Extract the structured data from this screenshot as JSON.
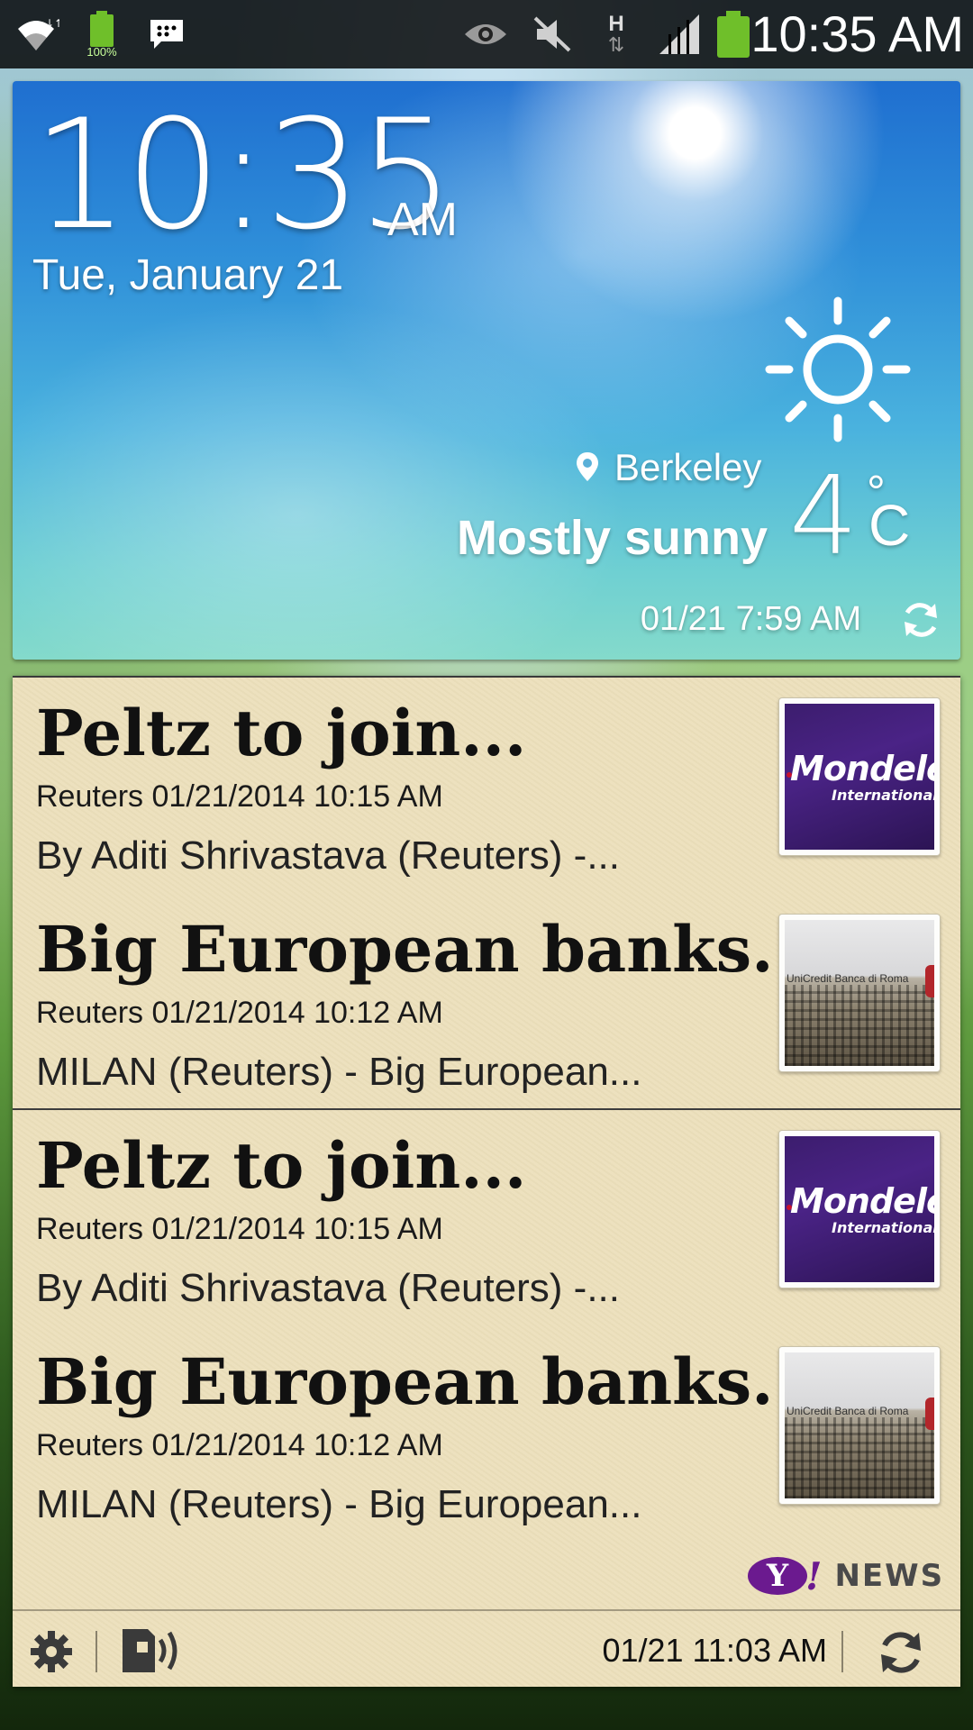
{
  "status_bar": {
    "icons": [
      "wifi-icon",
      "battery-small-icon",
      "bbm-message-icon",
      "eye-icon",
      "mute-icon",
      "network-h-icon",
      "signal-icon",
      "battery-icon"
    ],
    "battery_percent_label": "100%",
    "network_type": "H",
    "time": "10:35 AM"
  },
  "clock_widget": {
    "time": "10:35",
    "ampm": "AM",
    "date": "Tue, January 21",
    "weather": {
      "location": "Berkeley",
      "condition": "Mostly sunny",
      "temperature": "4",
      "degree_symbol": "°",
      "unit": "C",
      "updated": "01/21 7:59 AM",
      "icon": "sun-icon"
    }
  },
  "news_widget": {
    "items": [
      {
        "title": "Peltz to join...",
        "meta": "Reuters 01/21/2014 10:15 AM",
        "snippet": "By Aditi Shrivastava (Reuters) -...",
        "thumb_text": "Mondelēz",
        "thumb_subtext": "International"
      },
      {
        "title": "Big European banks...",
        "meta": "Reuters 01/21/2014 10:12 AM",
        "snippet": "MILAN (Reuters) - Big European...",
        "thumb_text": "UniCredit Banca di Roma"
      },
      {
        "title": "Peltz to join...",
        "meta": "Reuters 01/21/2014 10:15 AM",
        "snippet": "By Aditi Shrivastava (Reuters) -...",
        "thumb_text": "Mondelēz",
        "thumb_subtext": "International"
      },
      {
        "title": "Big European banks...",
        "meta": "Reuters 01/21/2014 10:12 AM",
        "snippet": "MILAN (Reuters) - Big European...",
        "thumb_text": "UniCredit Banca di Roma"
      }
    ],
    "brand": {
      "logo_letter": "Y",
      "logo_bang": "!",
      "word": "NEWS"
    },
    "footer": {
      "updated": "01/21 11:03 AM"
    }
  },
  "colors": {
    "news_background": "#ece0bc",
    "yahoo_purple": "#6b1a8f",
    "battery_green": "#6fbf2a"
  }
}
